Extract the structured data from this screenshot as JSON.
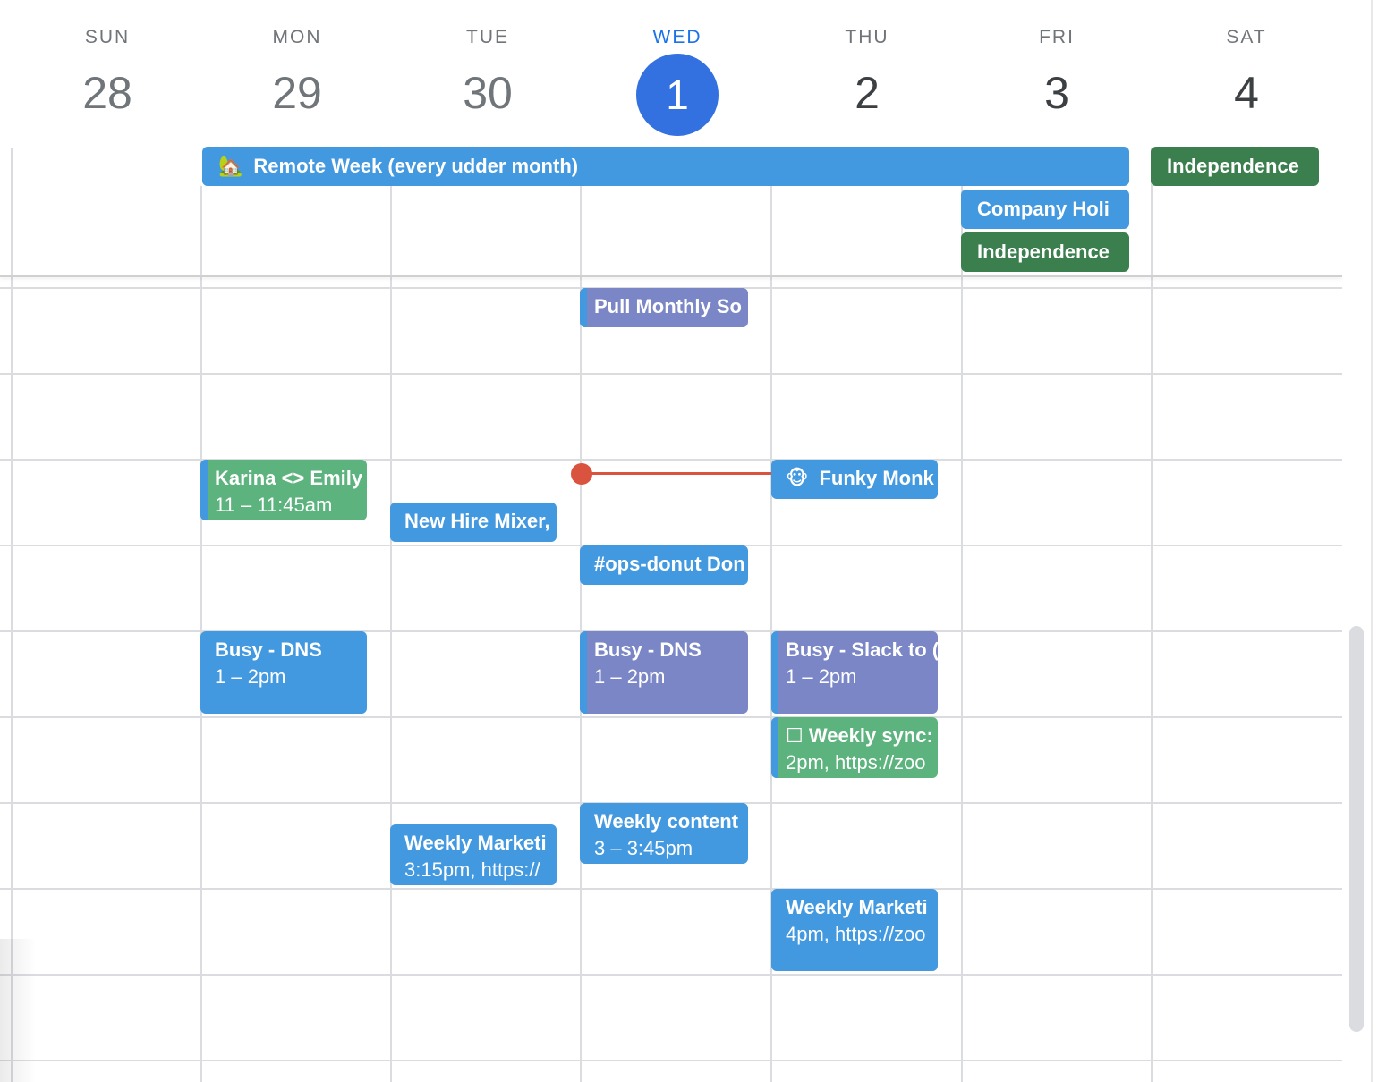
{
  "days": [
    {
      "dow": "SUN",
      "date": "28",
      "state": "past"
    },
    {
      "dow": "MON",
      "date": "29",
      "state": "past"
    },
    {
      "dow": "TUE",
      "date": "30",
      "state": "past"
    },
    {
      "dow": "WED",
      "date": "1",
      "state": "today"
    },
    {
      "dow": "THU",
      "date": "2",
      "state": "future"
    },
    {
      "dow": "FRI",
      "date": "3",
      "state": "future"
    },
    {
      "dow": "SAT",
      "date": "4",
      "state": "future"
    }
  ],
  "all_day_events": [
    {
      "icon": "house-with-garden-icon",
      "icon_glyph": "🏡",
      "title": "Remote Week (every udder month)",
      "color": "#4399e0",
      "start_day": "MON",
      "end_day": "FRI"
    },
    {
      "title": "Company Holi",
      "color": "#4399e0",
      "day": "FRI"
    },
    {
      "title": "Independence",
      "color": "#3a7f4d",
      "day": "FRI"
    },
    {
      "title": "Independence",
      "color": "#3a7f4d",
      "day": "SAT"
    }
  ],
  "timed_events": [
    {
      "day": "WED",
      "title": "Pull Monthly So",
      "time": "",
      "color": "#7a86c6"
    },
    {
      "day": "MON",
      "title": "Karina <> Emily",
      "time": "11 – 11:45am",
      "color": "#5db37e"
    },
    {
      "day": "TUE",
      "title": "New Hire Mixer,",
      "time": "",
      "color": "#4399e0"
    },
    {
      "day": "THU",
      "icon": "monkey-face-icon",
      "icon_glyph": "🐵",
      "title": "Funky Monk",
      "time": "",
      "color": "#4399e0"
    },
    {
      "day": "WED",
      "title": "#ops-donut Don",
      "time": "",
      "color": "#4399e0"
    },
    {
      "day": "MON",
      "title": "Busy - DNS",
      "time": "1 – 2pm",
      "color": "#4399e0"
    },
    {
      "day": "WED",
      "title": "Busy - DNS",
      "time": "1 – 2pm",
      "color": "#7a86c6"
    },
    {
      "day": "THU",
      "title": "Busy - Slack to (",
      "time": "1 – 2pm",
      "color": "#7a86c6"
    },
    {
      "day": "THU",
      "title": "☐ Weekly sync:",
      "time": "2pm, https://zoo",
      "color": "#5db37e"
    },
    {
      "day": "TUE",
      "title": "Weekly Marketi",
      "time": "3:15pm, https://",
      "color": "#4399e0"
    },
    {
      "day": "WED",
      "title": "Weekly content",
      "time": "3 – 3:45pm",
      "color": "#4399e0"
    },
    {
      "day": "THU",
      "title": "Weekly Marketi",
      "time": "4pm, https://zoo",
      "color": "#4399e0"
    }
  ],
  "colors": {
    "today_accent": "#3370e0",
    "now_indicator": "#d9533f",
    "event_blue": "#4399e0",
    "event_purple": "#7a86c6",
    "event_green": "#5db37e",
    "holiday_green": "#3a7f4d"
  }
}
